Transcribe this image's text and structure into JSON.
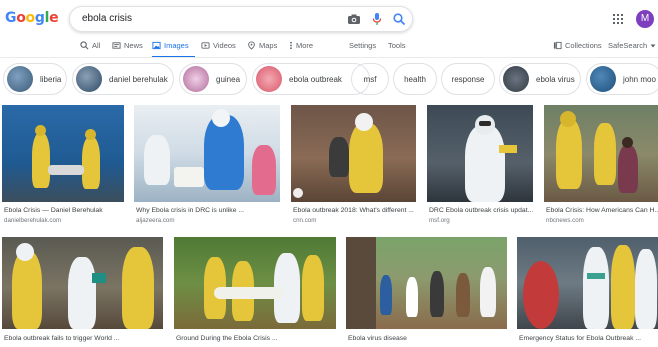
{
  "logo": {
    "letters": [
      {
        "ch": "G",
        "color": "#4285f4"
      },
      {
        "ch": "o",
        "color": "#ea4335"
      },
      {
        "ch": "o",
        "color": "#fbbc05"
      },
      {
        "ch": "g",
        "color": "#4285f4"
      },
      {
        "ch": "l",
        "color": "#34a853"
      },
      {
        "ch": "e",
        "color": "#ea4335"
      }
    ]
  },
  "search": {
    "query": "ebola crisis"
  },
  "user": {
    "initial": "M"
  },
  "tabs": {
    "all": "All",
    "news": "News",
    "images": "Images",
    "videos": "Videos",
    "maps": "Maps",
    "more": "More",
    "settings": "Settings",
    "tools": "Tools",
    "collections": "Collections",
    "safesearch": "SafeSearch"
  },
  "chips": [
    {
      "label": "liberia",
      "color": "#3a5a78"
    },
    {
      "label": "daniel berehulak",
      "color": "#2f4a66"
    },
    {
      "label": "guinea",
      "color": "#b06a9a"
    },
    {
      "label": "ebola outbreak",
      "color": "#d9566a"
    },
    {
      "label": "msf"
    },
    {
      "label": "health"
    },
    {
      "label": "response"
    },
    {
      "label": "ebola virus",
      "color": "#333b44"
    },
    {
      "label": "john moo",
      "color": "#1f4f7a"
    }
  ],
  "results_row1": [
    {
      "caption": "Ebola Crisis — Daniel Berehulak",
      "source": "danielberehulak.com"
    },
    {
      "caption": "Why Ebola crisis in DRC is unlike ...",
      "source": "aljazeera.com"
    },
    {
      "caption": "Ebola outbreak 2018: What's different ...",
      "source": "cnn.com"
    },
    {
      "caption": "DRC Ebola outbreak crisis updat...",
      "source": "msf.org"
    },
    {
      "caption": "Ebola Crisis: How Americans Can H...",
      "source": "nbcnews.com"
    }
  ],
  "results_row2": [
    {
      "caption": "Ebola outbreak fails to trigger World ..."
    },
    {
      "caption": "Ground During the Ebola Crisis ..."
    },
    {
      "caption": "Ebola virus disease"
    },
    {
      "caption": "Emergency Status for Ebola Outbreak ..."
    }
  ],
  "colors": {
    "accent": "#1a73e8",
    "suit_yellow": "#e5c53a",
    "suit_white": "#eef2f4"
  }
}
